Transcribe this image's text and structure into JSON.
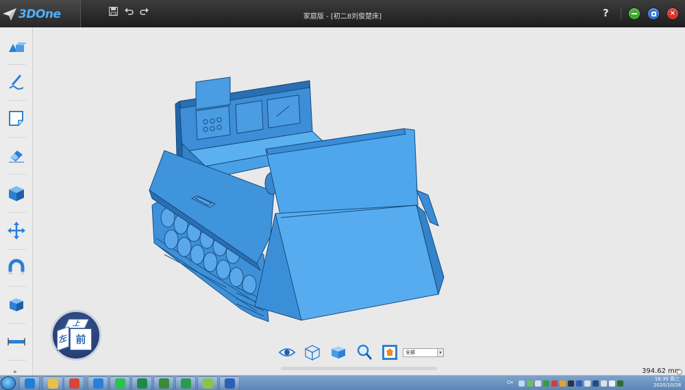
{
  "app": {
    "logo_text": "3DOne",
    "title": "家庭版 - [初二8刘俊楚床]"
  },
  "titlebar": {
    "help_label": "?",
    "icons": [
      "save-icon",
      "undo-icon",
      "redo-icon"
    ],
    "window_buttons": [
      {
        "name": "minimize-button",
        "color": "#3faa2c"
      },
      {
        "name": "restore-button",
        "color": "#2d78d6"
      },
      {
        "name": "close-button",
        "color": "#d9342b"
      }
    ]
  },
  "left_toolbar": {
    "tools": [
      "basic-shapes-tool",
      "sketch-tool",
      "sketch-edit-tool",
      "special-feature-tool",
      "special-function-tool",
      "basic-edit-tool",
      "combine-tool",
      "parts-library-tool",
      "distance-measure-tool"
    ],
    "expander": "»"
  },
  "viewcube": {
    "top": "上",
    "left": "左",
    "front": "前"
  },
  "bottom_toolbar": {
    "tools": [
      "display-toggle-tool",
      "wireframe-view-tool",
      "shaded-view-tool",
      "zoom-to-fit-tool",
      "view-select-tool"
    ],
    "filter_value": "全部"
  },
  "status": {
    "measurement": "394.62 mm"
  },
  "taskbar": {
    "apps": [
      {
        "name": "ie-taskbar-button",
        "color": "#1f7fd8"
      },
      {
        "name": "explorer-taskbar-button",
        "color": "#e8c04a"
      },
      {
        "name": "chrome-taskbar-button",
        "color": "#db4437"
      },
      {
        "name": "sogou-taskbar-button",
        "color": "#2b7de0"
      },
      {
        "name": "wechat-taskbar-button",
        "color": "#2ec04a"
      },
      {
        "name": "excel-taskbar-button",
        "color": "#1e8a45"
      },
      {
        "name": "app-taskbar-button",
        "color": "#3b8a3b"
      },
      {
        "name": "3done-taskbar-button",
        "color": "#2c9b4e"
      },
      {
        "name": "pen-app-taskbar-button",
        "color": "#8bc34a"
      },
      {
        "name": "word-taskbar-button",
        "color": "#2b5fb8"
      }
    ],
    "tray_label": "CH",
    "clock_time": "16:35 周三",
    "clock_date": "2020/10/28"
  }
}
